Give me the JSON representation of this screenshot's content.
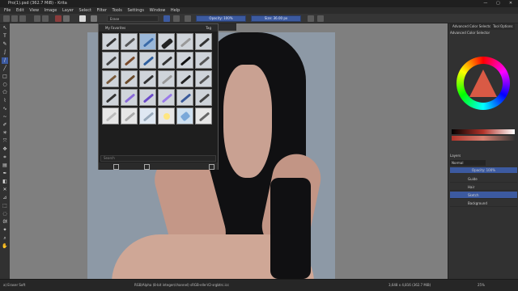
{
  "window": {
    "title": "Pro(1).psd (362.7 MiB) - Krita",
    "min_label": "—",
    "max_label": "▢",
    "close_label": "✕"
  },
  "menu": [
    "File",
    "Edit",
    "View",
    "Image",
    "Layer",
    "Select",
    "Filter",
    "Tools",
    "Settings",
    "Window",
    "Help"
  ],
  "toolbar": {
    "blend_mode": "Erase",
    "opacity_label": "Opacity: 100%",
    "opacity_value": 1.0,
    "size_label": "Size: 36.00 px"
  },
  "document_tab": "Pro(1).psd",
  "popup": {
    "title": "My Favorites",
    "tag_label": "Tag",
    "search_placeholder": "Search"
  },
  "right_dock": {
    "tab1": "Advanced Color Selector",
    "tab2": "Tool Options",
    "sub_tab": "Advanced Color Selector",
    "layers_title": "Layers",
    "blend": "Normal",
    "opacity": "Opacity: 100%",
    "layers": [
      "Guide",
      "Hair",
      "Sketch",
      "Background"
    ]
  },
  "status": {
    "brush": "a) Eraser Soft",
    "color_info": "RGB/Alpha (8-bit integer/channel)  sRGB-elle-V2-srgbtrc.icc",
    "doc_info": "3,648 x 4,816 (362.7 MiB)",
    "zoom": "25%"
  }
}
